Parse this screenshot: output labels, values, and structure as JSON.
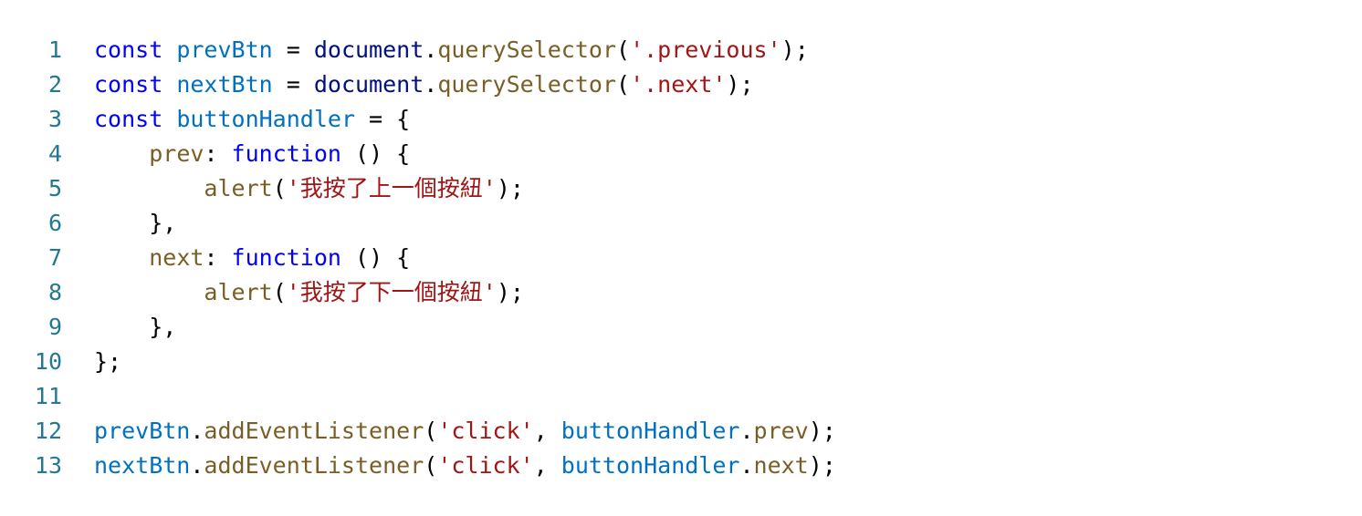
{
  "colors": {
    "background": "#ffffff",
    "line_number": "#237893",
    "keyword": "#0000ff",
    "variable": "#0070c1",
    "function": "#795e26",
    "string": "#a31515",
    "object": "#001080",
    "punctuation": "#000000"
  },
  "lines": [
    {
      "number": "1",
      "tokens": [
        {
          "t": "const",
          "c": "kw"
        },
        {
          "t": " ",
          "c": "punc"
        },
        {
          "t": "prevBtn",
          "c": "var"
        },
        {
          "t": " = ",
          "c": "punc"
        },
        {
          "t": "document",
          "c": "obj"
        },
        {
          "t": ".",
          "c": "punc"
        },
        {
          "t": "querySelector",
          "c": "fn"
        },
        {
          "t": "(",
          "c": "punc"
        },
        {
          "t": "'.previous'",
          "c": "str"
        },
        {
          "t": ");",
          "c": "punc"
        }
      ]
    },
    {
      "number": "2",
      "tokens": [
        {
          "t": "const",
          "c": "kw"
        },
        {
          "t": " ",
          "c": "punc"
        },
        {
          "t": "nextBtn",
          "c": "var"
        },
        {
          "t": " = ",
          "c": "punc"
        },
        {
          "t": "document",
          "c": "obj"
        },
        {
          "t": ".",
          "c": "punc"
        },
        {
          "t": "querySelector",
          "c": "fn"
        },
        {
          "t": "(",
          "c": "punc"
        },
        {
          "t": "'.next'",
          "c": "str"
        },
        {
          "t": ");",
          "c": "punc"
        }
      ]
    },
    {
      "number": "3",
      "tokens": [
        {
          "t": "const",
          "c": "kw"
        },
        {
          "t": " ",
          "c": "punc"
        },
        {
          "t": "buttonHandler",
          "c": "var"
        },
        {
          "t": " = {",
          "c": "punc"
        }
      ]
    },
    {
      "number": "4",
      "tokens": [
        {
          "t": "    ",
          "c": "punc"
        },
        {
          "t": "prev",
          "c": "prop"
        },
        {
          "t": ": ",
          "c": "punc"
        },
        {
          "t": "function",
          "c": "kw"
        },
        {
          "t": " () {",
          "c": "punc"
        }
      ]
    },
    {
      "number": "5",
      "tokens": [
        {
          "t": "        ",
          "c": "punc"
        },
        {
          "t": "alert",
          "c": "fn"
        },
        {
          "t": "(",
          "c": "punc"
        },
        {
          "t": "'我按了上一個按紐'",
          "c": "str"
        },
        {
          "t": ");",
          "c": "punc"
        }
      ]
    },
    {
      "number": "6",
      "tokens": [
        {
          "t": "    },",
          "c": "punc"
        }
      ]
    },
    {
      "number": "7",
      "tokens": [
        {
          "t": "    ",
          "c": "punc"
        },
        {
          "t": "next",
          "c": "prop"
        },
        {
          "t": ": ",
          "c": "punc"
        },
        {
          "t": "function",
          "c": "kw"
        },
        {
          "t": " () {",
          "c": "punc"
        }
      ]
    },
    {
      "number": "8",
      "tokens": [
        {
          "t": "        ",
          "c": "punc"
        },
        {
          "t": "alert",
          "c": "fn"
        },
        {
          "t": "(",
          "c": "punc"
        },
        {
          "t": "'我按了下一個按紐'",
          "c": "str"
        },
        {
          "t": ");",
          "c": "punc"
        }
      ]
    },
    {
      "number": "9",
      "tokens": [
        {
          "t": "    },",
          "c": "punc"
        }
      ]
    },
    {
      "number": "10",
      "tokens": [
        {
          "t": "};",
          "c": "punc"
        }
      ]
    },
    {
      "number": "11",
      "tokens": []
    },
    {
      "number": "12",
      "tokens": [
        {
          "t": "prevBtn",
          "c": "var"
        },
        {
          "t": ".",
          "c": "punc"
        },
        {
          "t": "addEventListener",
          "c": "fn"
        },
        {
          "t": "(",
          "c": "punc"
        },
        {
          "t": "'click'",
          "c": "str"
        },
        {
          "t": ", ",
          "c": "punc"
        },
        {
          "t": "buttonHandler",
          "c": "var"
        },
        {
          "t": ".",
          "c": "punc"
        },
        {
          "t": "prev",
          "c": "prop"
        },
        {
          "t": ");",
          "c": "punc"
        }
      ]
    },
    {
      "number": "13",
      "tokens": [
        {
          "t": "nextBtn",
          "c": "var"
        },
        {
          "t": ".",
          "c": "punc"
        },
        {
          "t": "addEventListener",
          "c": "fn"
        },
        {
          "t": "(",
          "c": "punc"
        },
        {
          "t": "'click'",
          "c": "str"
        },
        {
          "t": ", ",
          "c": "punc"
        },
        {
          "t": "buttonHandler",
          "c": "var"
        },
        {
          "t": ".",
          "c": "punc"
        },
        {
          "t": "next",
          "c": "prop"
        },
        {
          "t": ");",
          "c": "punc"
        }
      ]
    }
  ]
}
